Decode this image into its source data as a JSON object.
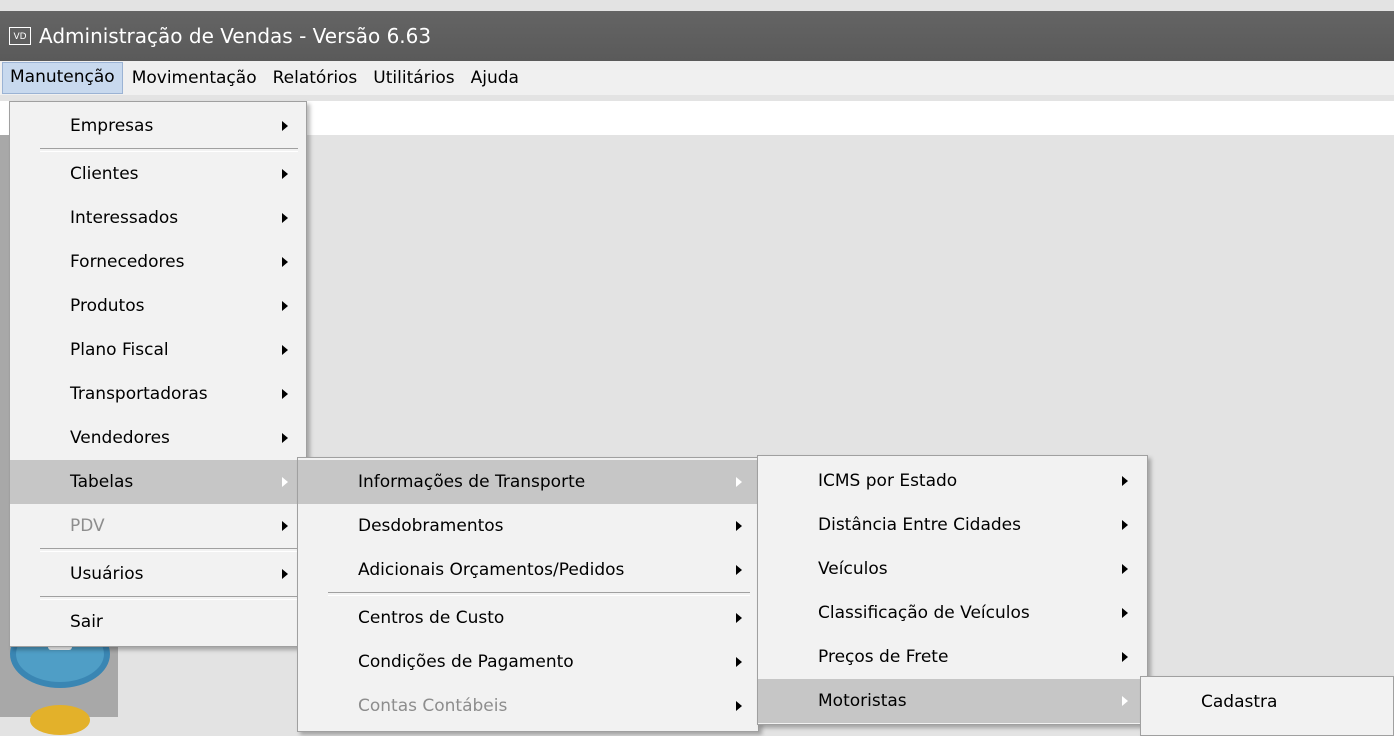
{
  "window": {
    "icon_text": "VD",
    "title": "Administração de Vendas - Versão 6.63"
  },
  "menubar": [
    "Manutenção",
    "Movimentação",
    "Relatórios",
    "Utilitários",
    "Ajuda"
  ],
  "menu_manutencao": {
    "empresas": "Empresas",
    "clientes": "Clientes",
    "interessados": "Interessados",
    "fornecedores": "Fornecedores",
    "produtos": "Produtos",
    "plano_fiscal": "Plano Fiscal",
    "transportadoras": "Transportadoras",
    "vendedores": "Vendedores",
    "tabelas": "Tabelas",
    "pdv": "PDV",
    "usuarios": "Usuários",
    "sair": "Sair"
  },
  "menu_tabelas": {
    "info_transporte": "Informações de Transporte",
    "desdobramentos": "Desdobramentos",
    "adicionais": "Adicionais Orçamentos/Pedidos",
    "centros_custo": "Centros de Custo",
    "condicoes_pagamento": "Condições de Pagamento",
    "contas_contabeis": "Contas Contábeis"
  },
  "menu_transporte": {
    "icms": "ICMS por Estado",
    "distancia": "Distância Entre Cidades",
    "veiculos": "Veículos",
    "classificacao": "Classificação de Veículos",
    "precos_frete": "Preços de Frete",
    "motoristas": "Motoristas"
  },
  "menu_motoristas": {
    "cadastra": "Cadastra"
  }
}
